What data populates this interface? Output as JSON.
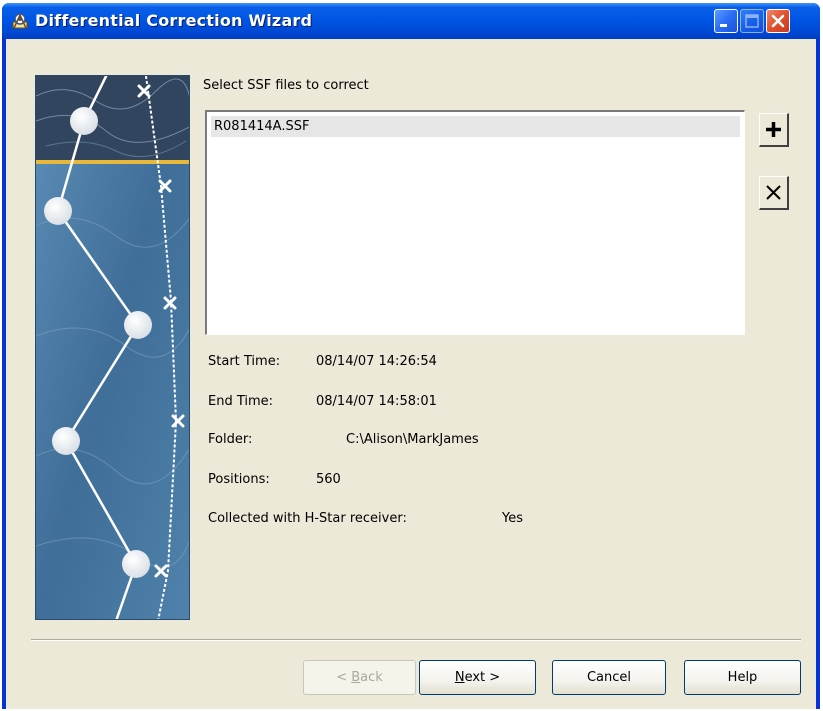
{
  "window": {
    "title": "Differential Correction Wizard",
    "icon": "wizard-app-icon"
  },
  "title_buttons": {
    "minimize_icon": "minimize-icon",
    "maximize_icon": "maximize-icon",
    "close_icon": "close-icon"
  },
  "files": {
    "label": "Select SSF files to correct",
    "items": [
      "R081414A.SSF"
    ],
    "add_icon": "plus-icon",
    "remove_icon": "x-icon"
  },
  "details": {
    "start_time_label": "Start Time:",
    "start_time": "08/14/07 14:26:54",
    "end_time_label": "End Time:",
    "end_time": "08/14/07 14:58:01",
    "folder_label": "Folder:",
    "folder": "C:\\Alison\\MarkJames",
    "positions_label": "Positions:",
    "positions": "560",
    "hstar_label": "Collected with H-Star receiver:",
    "hstar": "Yes"
  },
  "buttons": {
    "back_prefix": "< ",
    "back_mnemonic": "B",
    "back_rest": "ack",
    "next_mnemonic": "N",
    "next_rest": "ext >",
    "cancel": "Cancel",
    "help": "Help"
  },
  "colors": {
    "titlebar": "#0055e5",
    "client": "#ece9d8",
    "close_button": "#e0512c",
    "accent_line": "#e8b83a"
  }
}
